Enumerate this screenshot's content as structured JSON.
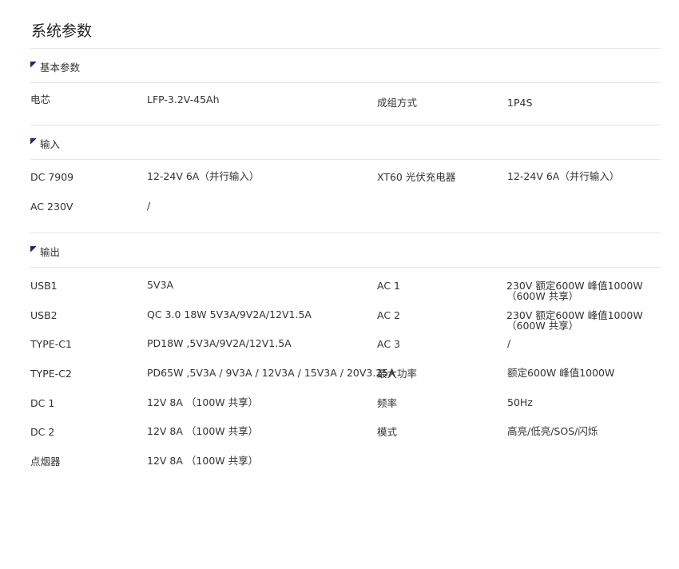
{
  "title": "系统参数",
  "sections": [
    {
      "heading": "基本参数",
      "rows": [
        {
          "left_label": "电芯",
          "left_value": "LFP-3.2V-45Ah",
          "right_label": "成组方式",
          "right_value": "1P4S"
        }
      ]
    },
    {
      "heading": "输入",
      "rows": [
        {
          "left_label": "DC 7909",
          "left_value": "12-24V 6A（并行输入）",
          "right_label": "XT60 光伏充电器",
          "right_value": "12-24V 6A（并行输入）"
        },
        {
          "left_label": "AC 230V",
          "left_value": "/"
        }
      ]
    },
    {
      "heading": "输出",
      "rows": [
        {
          "left_label": "USB1",
          "left_value": "5V3A",
          "right_label": "AC 1",
          "right_value_line1": "230V 额定600W 峰值1000W",
          "right_value_line2": "（600W 共享）"
        },
        {
          "left_label": "USB2",
          "left_value": "QC 3.0 18W 5V3A/9V2A/12V1.5A",
          "right_label": "AC 2",
          "right_value_line1": "230V 额定600W 峰值1000W",
          "right_value_line2": "（600W 共享）"
        },
        {
          "left_label": "TYPE-C1",
          "left_value": "PD18W ,5V3A/9V2A/12V1.5A",
          "right_label": "AC 3",
          "right_value": "/"
        },
        {
          "left_label": "TYPE-C2",
          "left_value": "PD65W ,5V3A / 9V3A / 12V3A / 15V3A / 20V3.25A",
          "right_label": "最大功率",
          "right_value": "额定600W 峰值1000W"
        },
        {
          "left_label": "DC 1",
          "left_value": "12V 8A （100W 共享）",
          "right_label": "频率",
          "right_value": "50Hz"
        },
        {
          "left_label": "DC 2",
          "left_value": "12V 8A （100W 共享）",
          "right_label": "模式",
          "right_value": "高亮/低亮/SOS/闪烁"
        },
        {
          "left_label": "点烟器",
          "left_value": "12V 8A （100W 共享）"
        }
      ]
    }
  ]
}
